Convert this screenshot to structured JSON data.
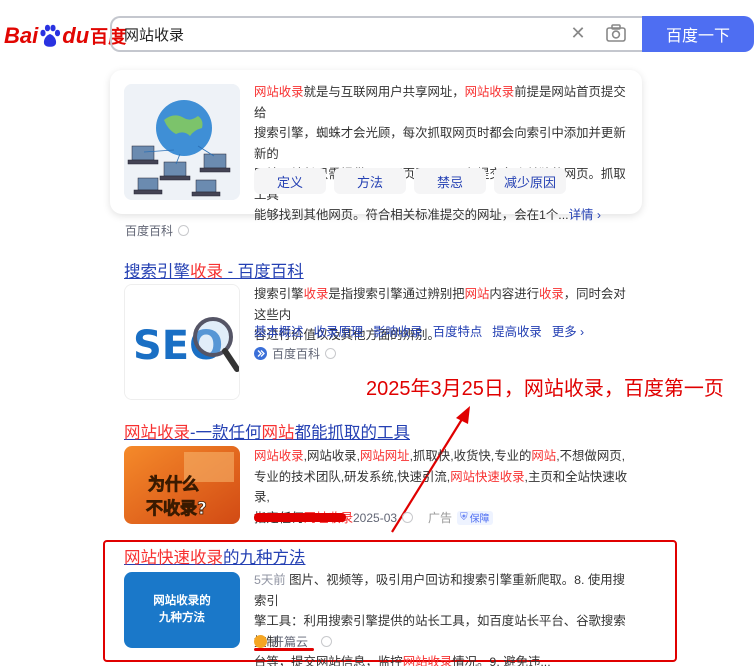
{
  "logo": {
    "bai": "Bai",
    "du": "du",
    "cn": "百度"
  },
  "search": {
    "query": "网站收录",
    "button": "百度一下"
  },
  "baike_card": {
    "lines": [
      [
        "网站收录",
        "就是与互联网用户共享网址，",
        "网站收录",
        "前提是网站首页提交给"
      ],
      [
        "搜索引擎，蜘蛛才会光顾，每次抓取网页时都会向索引中添加并更新新的"
      ],
      [
        "网站，站长只需提供顶层网页即可，不必提交各个单独的网页。抓取工具"
      ],
      [
        "能够找到其他网页。符合相关标准提交的网址，会在1个..."
      ]
    ],
    "more": "详情",
    "chips": [
      "定义",
      "方法",
      "禁忌",
      "减少原因"
    ],
    "source": "百度百科"
  },
  "result1": {
    "title_pre": "搜索引擎",
    "title_hl": "收录",
    "title_post": " - 百度百科",
    "lines": [
      [
        "搜索引擎",
        "收录",
        "是指搜索引擎通过辨别把",
        "网站",
        "内容进行",
        "收录",
        "，同时会对这些内"
      ],
      [
        "容进行价值以及其他方面的辨别。"
      ]
    ],
    "links": [
      "基本概述",
      "收录原理",
      "影响收录",
      "百度特点",
      "提高收录",
      "更多"
    ],
    "source": "百度百科",
    "image_text": "SEO"
  },
  "annotation": "2025年3月25日，网站收录，百度第一页",
  "result2": {
    "title_hl1": "网站收录",
    "title_mid": "-一款任何",
    "title_hl2": "网站",
    "title_post": "都能抓取的工具",
    "lines": [
      [
        "网站收录",
        ",网站收录,",
        "网站网址",
        ",抓取快,收货快,专业的",
        "网站",
        ",不想做网页,"
      ],
      [
        "专业的技术团队,研发系统,快速引流,",
        "网站快速收录",
        ",主页和全站快速收录,"
      ],
      [
        "指定任何",
        "网址收录"
      ]
    ],
    "date": "2025-03",
    "ad": "广告",
    "badge": "保障",
    "image_line1": "为什么",
    "image_line2": "不收录?"
  },
  "result3": {
    "title_hl1": "网站",
    "title_hl2": "快速",
    "title_hl3": "收录",
    "title_post": "的九种方法",
    "lines": [
      [
        "5天前",
        " 图片、视频等，吸引用户回访和搜索引擎重新爬取。8. 使用搜索引"
      ],
      [
        "擎工具：利用搜索引擎提供的站长工具，如百度站长平台、谷歌搜索控制"
      ],
      [
        "台等，提交网站信息，监控",
        "网站收录",
        "情况。9. 避免违..."
      ]
    ],
    "source": "开篇云",
    "image_line1": "网站收录的",
    "image_line2": "九种方法"
  },
  "colors": {
    "accent": "#4e6ef2",
    "link": "#2440b3",
    "highlight": "#f73131",
    "annotation": "#e00000"
  }
}
